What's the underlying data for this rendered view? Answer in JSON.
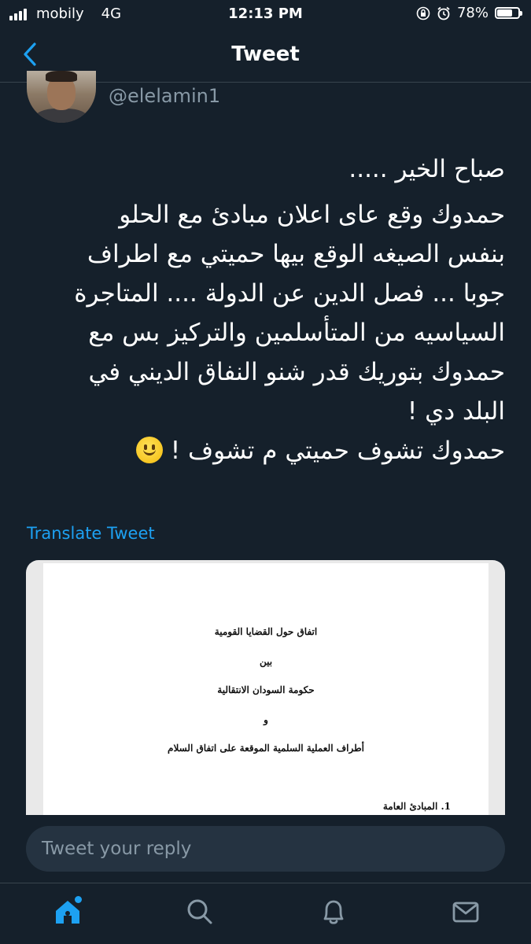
{
  "status_bar": {
    "carrier": "mobily",
    "network": "4G",
    "time": "12:13 PM",
    "battery": "78%",
    "battery_level": 0.78
  },
  "nav": {
    "back_icon": "chevron-left-icon",
    "title": "Tweet"
  },
  "tweet": {
    "handle": "@elelamin1",
    "text_lines": [
      "صباح الخير .....",
      "حمدوك وقع عاى اعلان مبادئ مع الحلو",
      "بنفس الصيغه الوقع بيها حميتي مع اطراف",
      "جوبا ... فصل الدين عن الدولة .... المتاجرة",
      "السياسيه من المتأسلمين والتركيز بس مع",
      "حمدوك بتوريك قدر شنو النفاق  الديني في",
      "البلد دي !",
      "حمدوك تشوف حميتي م تشوف  !"
    ],
    "emoji": "slightly-smiling-face-icon",
    "translate_label": "Translate Tweet"
  },
  "document": {
    "title": "اتفاق حول القضايا القومية",
    "between": "بين",
    "party1": "حكومة السودان الانتقالية",
    "and": "و",
    "party2": "أطراف العملية السلمية الموقعة على اتفاق السلام",
    "section": "1. المبادئ العامة"
  },
  "reply": {
    "placeholder": "Tweet your reply"
  },
  "tabs": [
    {
      "name": "home",
      "icon": "home-icon"
    },
    {
      "name": "search",
      "icon": "search-icon"
    },
    {
      "name": "notifications",
      "icon": "bell-icon"
    },
    {
      "name": "messages",
      "icon": "mail-icon"
    }
  ],
  "colors": {
    "background": "#15202b",
    "accent": "#1da1f2",
    "secondary_text": "#8899a6",
    "input_bg": "#253341"
  }
}
